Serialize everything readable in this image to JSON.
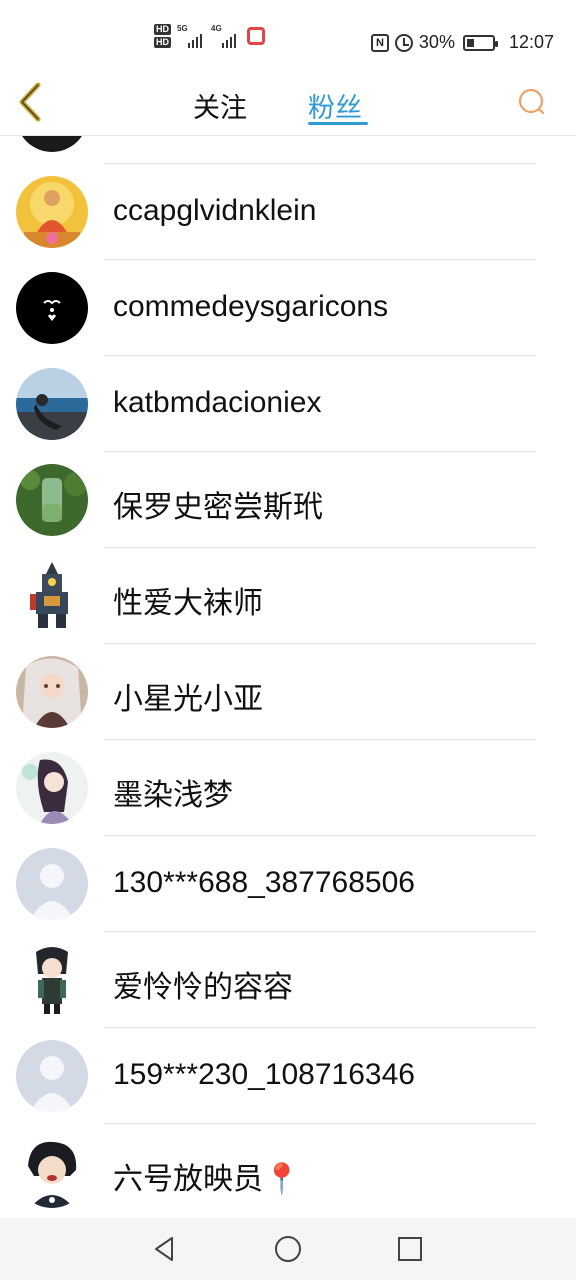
{
  "status_bar": {
    "hd1": "HD",
    "hd2": "HD",
    "net1": "5G",
    "net2": "4G",
    "battery_pct": "30%",
    "battery_level": 0.3,
    "time": "12:07"
  },
  "header": {
    "tabs": [
      {
        "label": "关注",
        "active": false
      },
      {
        "label": "粉丝",
        "active": true
      }
    ],
    "accent": "#2f9ad6",
    "back_color": "#c9a629",
    "search_color": "#f0a266"
  },
  "fans": [
    {
      "name": "",
      "avatar": "dark-partial"
    },
    {
      "name": "ccapglvidnklein",
      "avatar": "buddha"
    },
    {
      "name": "commedeysgaricons",
      "avatar": "black-logo"
    },
    {
      "name": "katbmdacioniex",
      "avatar": "sea-girl"
    },
    {
      "name": "保罗史密尝斯玳",
      "avatar": "green-jar"
    },
    {
      "name": "性爱大袜师",
      "avatar": "robot-figure"
    },
    {
      "name": "小星光小亚",
      "avatar": "anime-girl-1"
    },
    {
      "name": "墨染浅梦",
      "avatar": "anime-girl-2"
    },
    {
      "name": "130***688_387768506",
      "avatar": "default"
    },
    {
      "name": "爱怜怜的容容",
      "avatar": "chibi-figure"
    },
    {
      "name": "159***230_108716346",
      "avatar": "default"
    },
    {
      "name": "六号放映员📍",
      "avatar": "anime-boy"
    }
  ]
}
